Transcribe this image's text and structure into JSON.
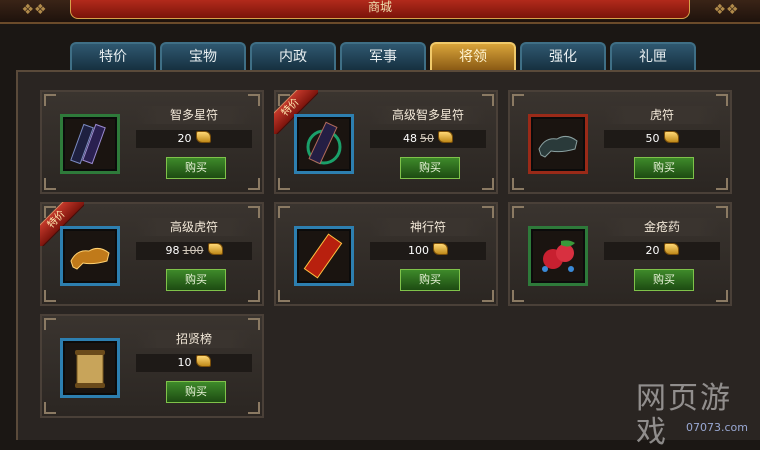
{
  "window": {
    "title": "商城"
  },
  "tabs": [
    {
      "label": "特价",
      "active": false
    },
    {
      "label": "宝物",
      "active": false
    },
    {
      "label": "内政",
      "active": false
    },
    {
      "label": "军事",
      "active": false
    },
    {
      "label": "将领",
      "active": true
    },
    {
      "label": "强化",
      "active": false
    },
    {
      "label": "礼匣",
      "active": false
    }
  ],
  "ribbon_label": "特价",
  "buy_label": "购买",
  "items": [
    {
      "name": "智多星符",
      "price": "20",
      "old_price": "",
      "currency_icon": "gold-ingot-icon",
      "icon": "book-talisman-icon",
      "sale": false
    },
    {
      "name": "高级智多星符",
      "price": "48",
      "old_price": "50",
      "currency_icon": "gold-ingot-icon",
      "icon": "book-talisman-icon",
      "sale": true
    },
    {
      "name": "虎符",
      "price": "50",
      "old_price": "",
      "currency_icon": "gold-ingot-icon",
      "icon": "tiger-tally-icon",
      "sale": false
    },
    {
      "name": "高级虎符",
      "price": "98",
      "old_price": "100",
      "currency_icon": "gold-ingot-icon",
      "icon": "tiger-tally-icon",
      "sale": true
    },
    {
      "name": "神行符",
      "price": "100",
      "old_price": "",
      "currency_icon": "gold-ingot-icon",
      "icon": "talisman-scroll-icon",
      "sale": false
    },
    {
      "name": "金疮药",
      "price": "20",
      "old_price": "",
      "currency_icon": "gold-ingot-icon",
      "icon": "herb-medicine-icon",
      "sale": false
    },
    {
      "name": "招贤榜",
      "price": "10",
      "old_price": "",
      "currency_icon": "gold-ingot-icon",
      "icon": "scroll-notice-icon",
      "sale": false
    }
  ],
  "watermark": {
    "text_big": "网页游戏",
    "text_small": "07073.com"
  },
  "colors": {
    "tab_active": "#d9a43a",
    "tab_normal": "#2f5870",
    "buy_button": "#3e8a2a",
    "ribbon": "#c3382a"
  }
}
